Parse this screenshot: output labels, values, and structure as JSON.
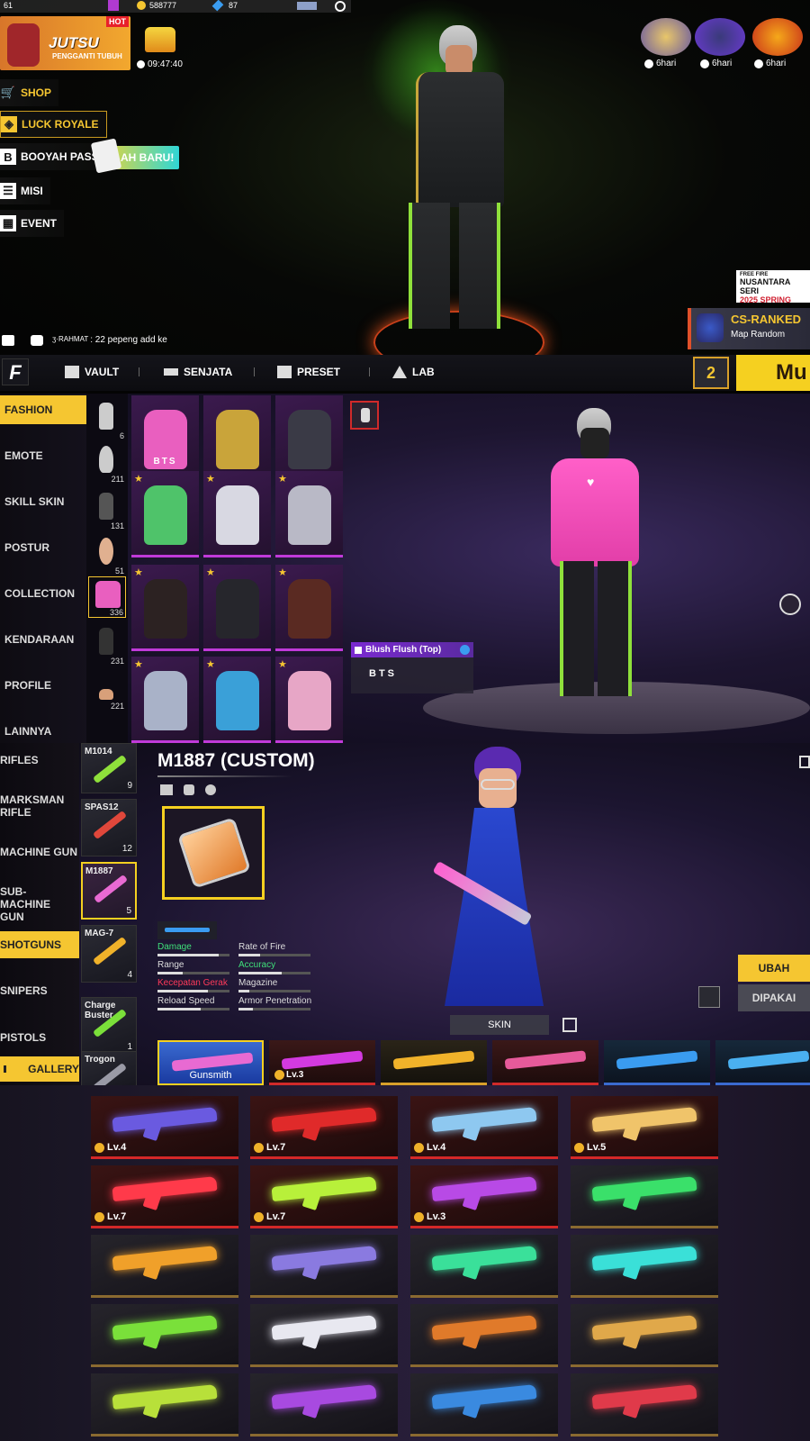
{
  "lobby": {
    "currency_gold": "588777",
    "currency_diamond": "87",
    "level": "61",
    "event_banner": {
      "hot_label": "HOT",
      "title": "JUTSU",
      "subtitle": "PENGGANTI TUBUH"
    },
    "chest_timer": "09:47:40",
    "left_menu": [
      {
        "label": "SHOP",
        "icon": "cart-icon"
      },
      {
        "label": "LUCK ROYALE",
        "icon": "luck-royale-icon"
      },
      {
        "label": "BOOYAH PASS",
        "icon": "booyah-pass-icon"
      },
      {
        "label": "MISI",
        "icon": "mission-icon"
      },
      {
        "label": "EVENT",
        "icon": "calendar-icon"
      }
    ],
    "new_badge": "AH BARU!",
    "event_timers": [
      {
        "label": "6hari"
      },
      {
        "label": "6hari"
      },
      {
        "label": "6hari"
      }
    ],
    "ranked": {
      "title": "CS-RANKED",
      "mode": "Map Random"
    },
    "promo": {
      "brand": "FREE FIRE",
      "line1": "NUSANTARA SERI",
      "line2": "2025 SPRING"
    },
    "chat": {
      "sender": "ʒ·RAHMAT",
      "message": ": 22 pepeng add ke"
    },
    "bottom_nav": [
      {
        "label": "VAULT",
        "icon": "vault-icon"
      },
      {
        "label": "SENJATA",
        "icon": "gun-icon"
      },
      {
        "label": "PRESET",
        "icon": "preset-icon"
      },
      {
        "label": "LAB",
        "icon": "lab-icon"
      }
    ],
    "mode_box": "2",
    "mode_button": "Mu"
  },
  "wardrobe": {
    "categories": [
      "FASHION",
      "EMOTE",
      "SKILL SKIN",
      "POSTUR",
      "COLLECTION",
      "KENDARAAN",
      "PROFILE",
      "LAINNYA"
    ],
    "active_category": "FASHION",
    "subcategories": [
      {
        "count": "6"
      },
      {
        "count": "211"
      },
      {
        "count": "131"
      },
      {
        "count": "51"
      },
      {
        "count": "336"
      },
      {
        "count": "231"
      },
      {
        "count": "221"
      }
    ],
    "items": [
      {
        "label": "BTS",
        "star": false,
        "color": "#e95fbf"
      },
      {
        "label": "",
        "star": false,
        "color": "#c9a43a"
      },
      {
        "label": "",
        "star": false,
        "color": "#3a3a46"
      },
      {
        "label": "",
        "star": true,
        "color": "#4fc36a"
      },
      {
        "label": "",
        "star": true,
        "color": "#d8d8e2"
      },
      {
        "label": "",
        "star": true,
        "color": "#b9b9c6"
      },
      {
        "label": "",
        "star": true,
        "color": "#2c2222"
      },
      {
        "label": "",
        "star": true,
        "color": "#26262c"
      },
      {
        "label": "",
        "star": true,
        "color": "#5a2a22"
      },
      {
        "label": "",
        "star": true,
        "color": "#a9b2c8"
      },
      {
        "label": "",
        "star": true,
        "color": "#3aa0d8"
      },
      {
        "label": "",
        "star": true,
        "color": "#e7a6c6"
      }
    ],
    "selected_item": {
      "name": "Blush Flush (Top)",
      "collection": "BTS"
    }
  },
  "weapons": {
    "categories": [
      "RIFLES",
      "MARKSMAN RIFLE",
      "MACHINE GUN",
      "SUB-MACHINE GUN",
      "SHOTGUNS",
      "SNIPERS",
      "PISTOLS"
    ],
    "active_category": "SHOTGUNS",
    "list": [
      {
        "name": "M1014",
        "count": "9",
        "color": "#8fe03b"
      },
      {
        "name": "SPAS12",
        "count": "12",
        "color": "#e0473b"
      },
      {
        "name": "M1887",
        "count": "5",
        "color": "#e86ad2"
      },
      {
        "name": "MAG-7",
        "count": "4",
        "color": "#f0b22a"
      },
      {
        "name": "Charge Buster",
        "count": "1",
        "color": "#7be03a"
      },
      {
        "name": "Trogon",
        "count": "",
        "color": "#9a9aa6"
      }
    ],
    "selected_weapon": "M1887 (CUSTOM)",
    "stats": [
      {
        "label": "Damage",
        "color": "#3fe07a",
        "value": 0.85
      },
      {
        "label": "Rate of Fire",
        "color": "#dddddd",
        "value": 0.3
      },
      {
        "label": "Range",
        "color": "#dddddd",
        "value": 0.35
      },
      {
        "label": "Accuracy",
        "color": "#3fe07a",
        "value": 0.6
      },
      {
        "label": "Kecepatan Gerak",
        "color": "#ff3a5a",
        "value": 0.7
      },
      {
        "label": "Magazine",
        "color": "#dddddd",
        "value": 0.15
      },
      {
        "label": "Reload Speed",
        "color": "#dddddd",
        "value": 0.6
      },
      {
        "label": "Armor Penetration",
        "color": "#dddddd",
        "value": 0.2
      }
    ],
    "buttons": {
      "change": "UBAH",
      "equipped": "DIPAKAI",
      "skin": "SKIN",
      "gallery": "GALLERY"
    },
    "skins": [
      {
        "label": "Gunsmith",
        "level": "",
        "color": "#e86ad2"
      },
      {
        "label": "",
        "level": "Lv.3",
        "color": "#d33ae0"
      },
      {
        "label": "",
        "level": "",
        "color": "#f0b22a"
      },
      {
        "label": "",
        "level": "",
        "color": "#e65a9a"
      },
      {
        "label": "",
        "level": "",
        "color": "#3a9cf0"
      },
      {
        "label": "",
        "level": "",
        "color": "#4ab0f0"
      }
    ]
  },
  "gallery": {
    "tiles": [
      {
        "level": "Lv.4",
        "color": "#6a5ae0",
        "red": true
      },
      {
        "level": "Lv.7",
        "color": "#e02a2a",
        "red": true
      },
      {
        "level": "Lv.4",
        "color": "#8ec8f0",
        "red": true
      },
      {
        "level": "Lv.5",
        "color": "#f0c46a",
        "red": true
      },
      {
        "level": "Lv.7",
        "color": "#ff3a4a",
        "red": true
      },
      {
        "level": "Lv.7",
        "color": "#b8f03a",
        "red": true
      },
      {
        "level": "Lv.3",
        "color": "#b84ae6",
        "red": true
      },
      {
        "level": "",
        "color": "#3ae06a",
        "red": false
      },
      {
        "level": "",
        "color": "#f0a02a",
        "red": false
      },
      {
        "level": "",
        "color": "#8a7ae0",
        "red": false
      },
      {
        "level": "",
        "color": "#3ae09a",
        "red": false
      },
      {
        "level": "",
        "color": "#3ae0d8",
        "red": false
      },
      {
        "level": "",
        "color": "#7ae03a",
        "red": false
      },
      {
        "level": "",
        "color": "#e8e8f0",
        "red": false
      },
      {
        "level": "",
        "color": "#e07a2a",
        "red": false
      },
      {
        "level": "",
        "color": "#e0a84a",
        "red": false
      },
      {
        "level": "",
        "color": "#b8e03a",
        "red": false
      },
      {
        "level": "",
        "color": "#a84ae0",
        "red": false
      },
      {
        "level": "",
        "color": "#3a8ae0",
        "red": false
      },
      {
        "level": "",
        "color": "#e03a4a",
        "red": false
      }
    ]
  }
}
